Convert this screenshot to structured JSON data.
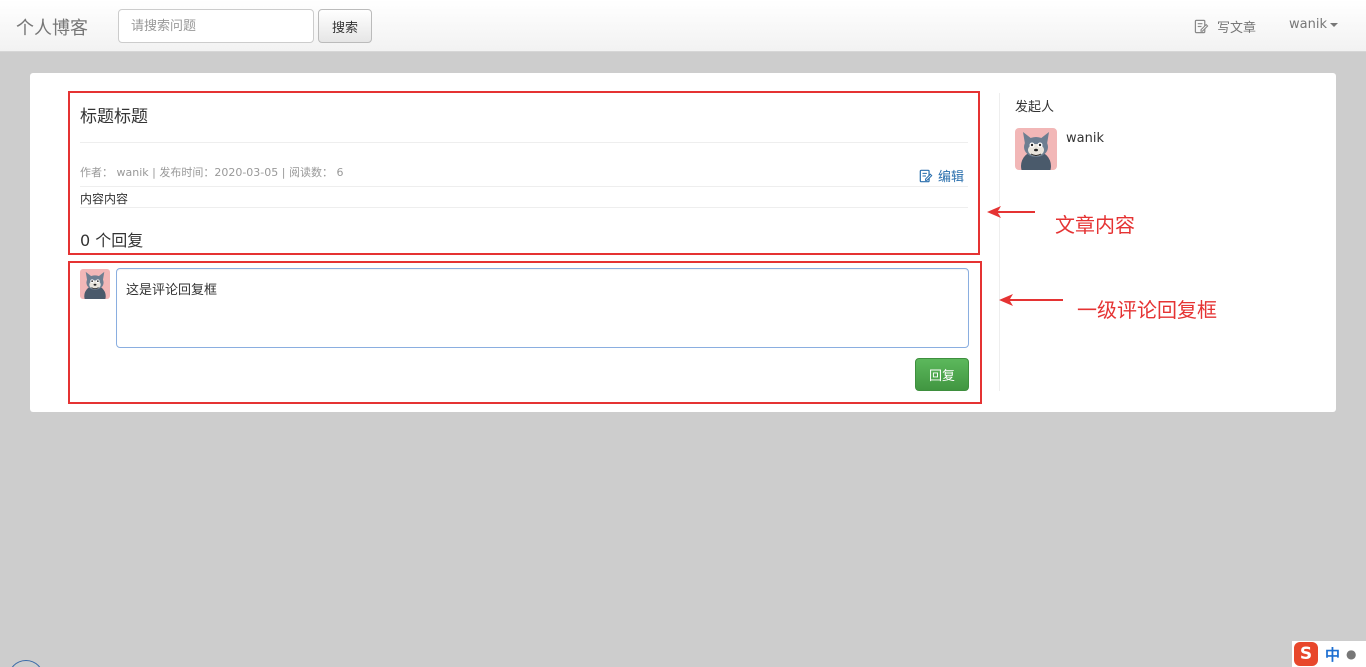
{
  "navbar": {
    "brand": "个人博客",
    "search_placeholder": "请搜索问题",
    "search_button": "搜索",
    "write_article": "写文章",
    "username": "wanik"
  },
  "article": {
    "title": "标题标题",
    "meta": "作者： wanik | 发布时间：2020-03-05 | 阅读数： 6",
    "edit_label": "编辑",
    "content": "内容内容",
    "reply_count": "0 个回复"
  },
  "comment": {
    "value": "这是评论回复框",
    "reply_button": "回复"
  },
  "sidebar": {
    "title": "发起人",
    "username": "wanik"
  },
  "annotations": {
    "article_content": "文章内容",
    "comment_box": "一级评论回复框"
  },
  "ime": {
    "logo": "S",
    "mode": "中"
  },
  "colors": {
    "annotation_red": "#e53333",
    "reply_green": "#4cae4c",
    "link_blue": "#2a6fad"
  }
}
